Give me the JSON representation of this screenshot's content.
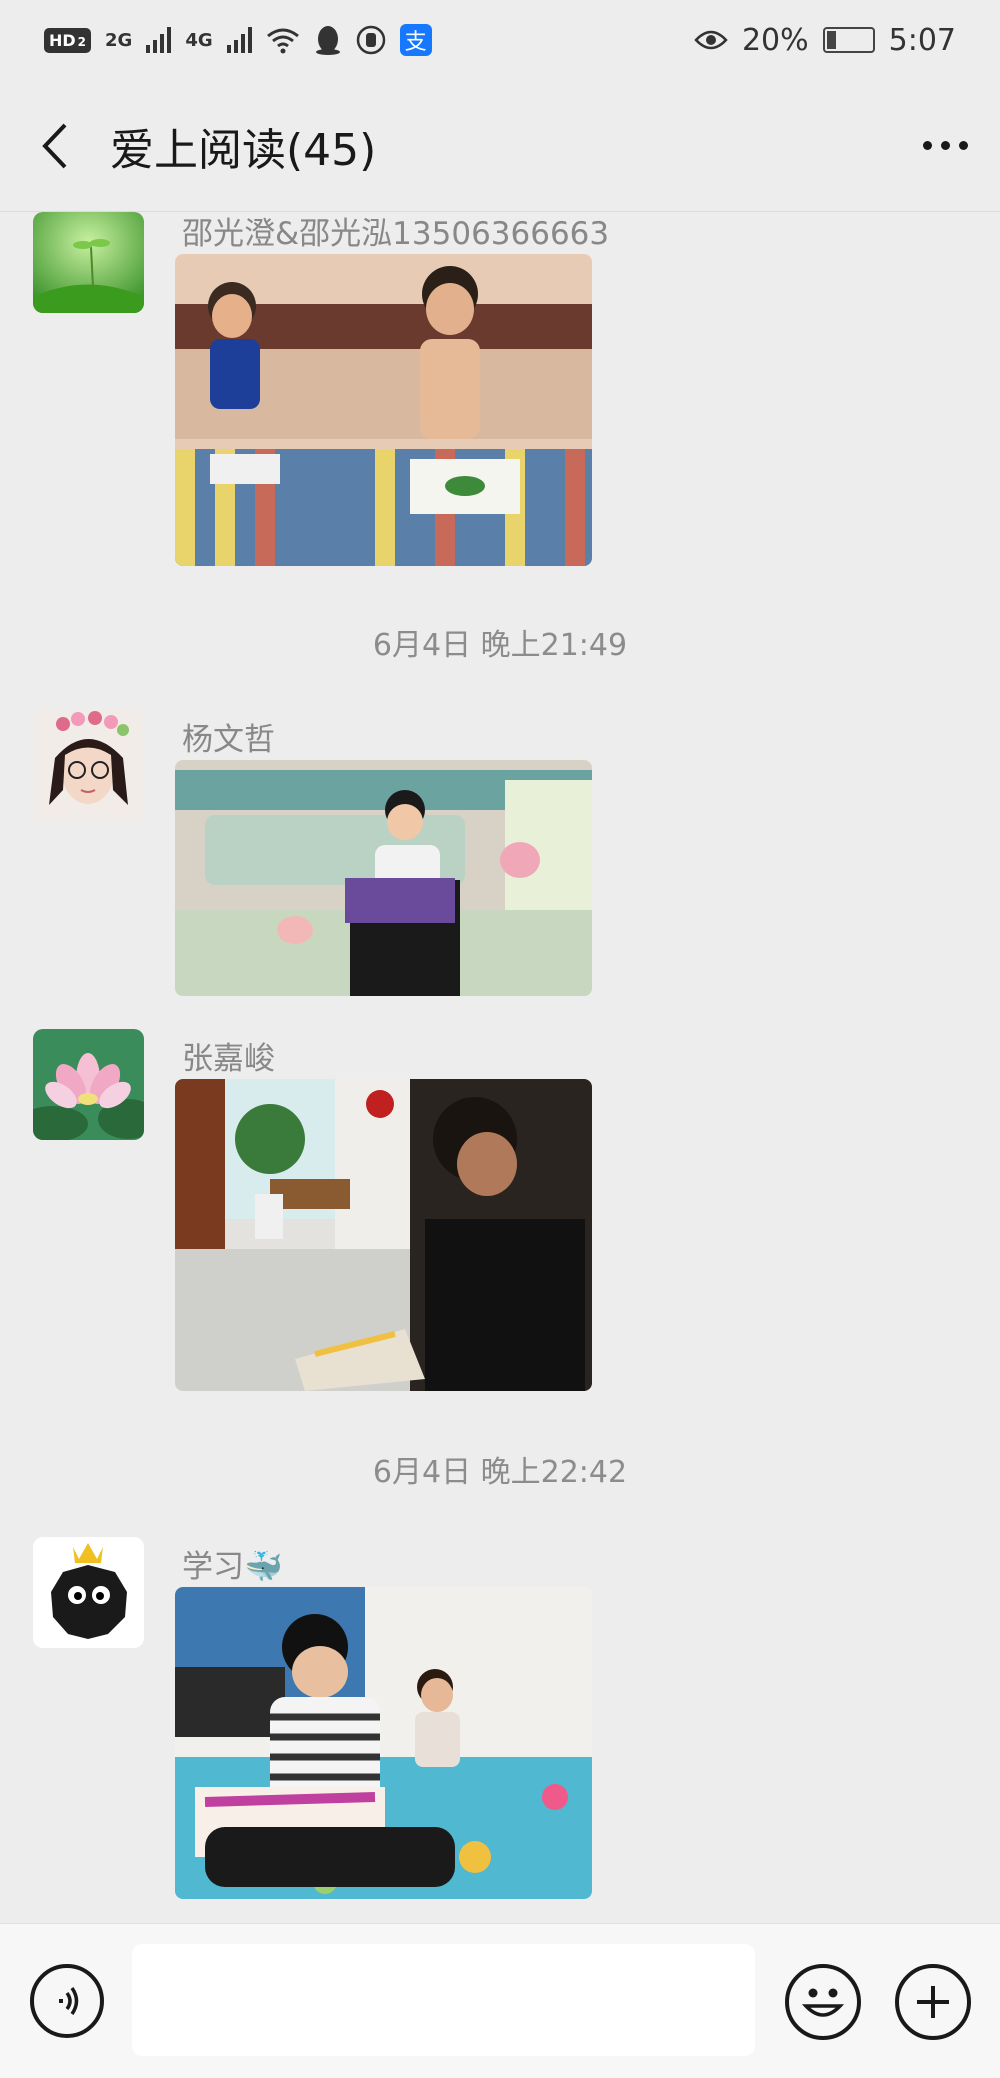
{
  "status_bar": {
    "hd_label": "HD",
    "sim_label": "2",
    "network_2g": "2G",
    "network_4g": "4G",
    "battery_percent": "20%",
    "time": "5:07",
    "alipay_glyph": "支"
  },
  "header": {
    "title": "爱上阅读(45)"
  },
  "messages": [
    {
      "sender": "邵光澄&邵光泓13506366663",
      "avatar": "leaf-sprout-avatar",
      "photo": "two-boys-reading-on-bed"
    },
    {
      "timestamp": "6月4日 晚上21:49"
    },
    {
      "sender": "杨文哲",
      "avatar": "woman-flower-crown-avatar",
      "photo": "boy-reading-in-bed"
    },
    {
      "sender": "张嘉峻",
      "avatar": "lotus-flower-avatar",
      "photo": "boy-reading-on-floor"
    },
    {
      "timestamp": "6月4日 晚上22:42"
    },
    {
      "sender": "学习🐳",
      "avatar": "black-soot-sprite-crown-avatar",
      "photo": "two-boys-reading-on-blanket"
    }
  ],
  "input_bar": {
    "placeholder": ""
  },
  "colors": {
    "background": "#ededed",
    "input_bar": "#f7f7f7",
    "alipay": "#1677ff"
  }
}
